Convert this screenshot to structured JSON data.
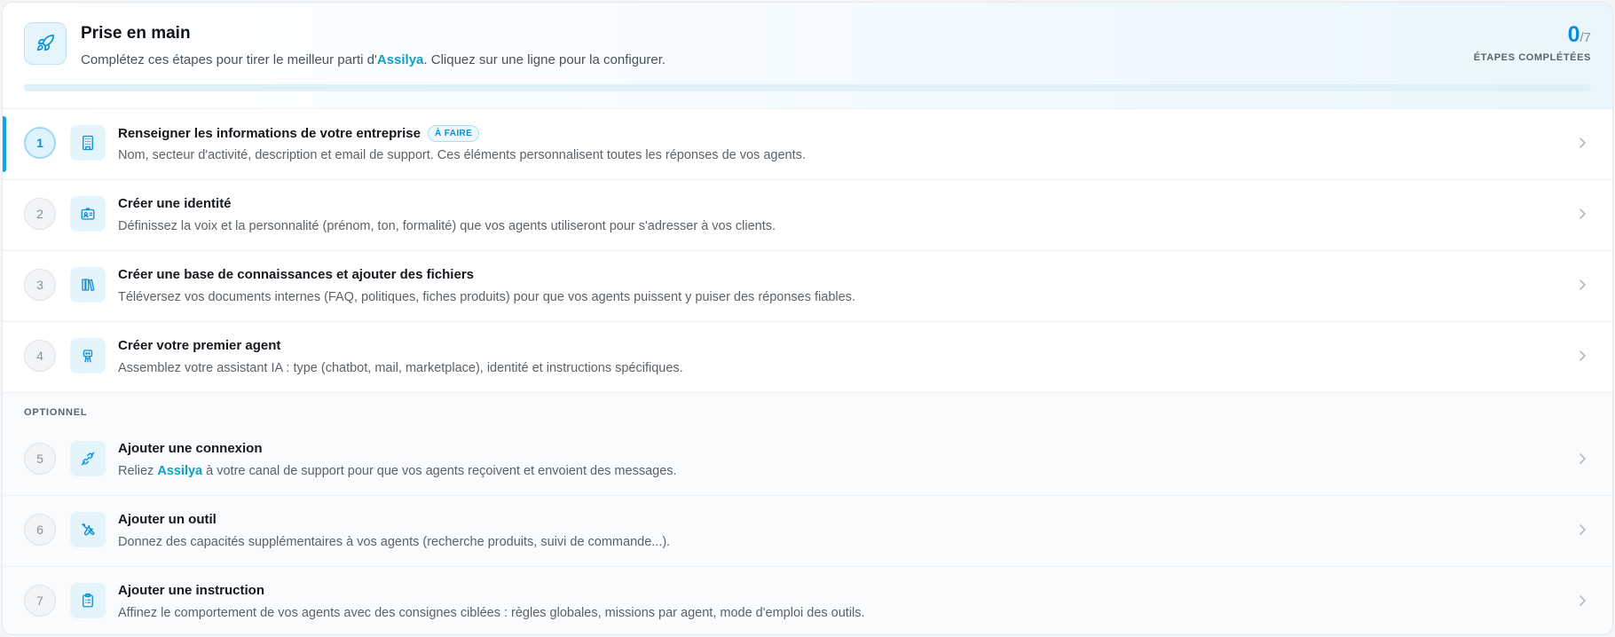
{
  "header": {
    "title": "Prise en main",
    "subtitle_before": "Complétez ces étapes pour tirer le meilleur parti d'",
    "brand": "Assilya",
    "subtitle_after": ". Cliquez sur une ligne pour la configurer.",
    "completed": "0",
    "total": "/7",
    "counter_label": "ÉTAPES COMPLÉTÉES",
    "progress": 0
  },
  "optional_label": "OPTIONNEL",
  "steps": [
    {
      "num": "1",
      "icon": "building-icon",
      "title": "Renseigner les informations de votre entreprise",
      "badge": "À FAIRE",
      "desc": "Nom, secteur d'activité, description et email de support. Ces éléments personnalisent toutes les réponses de vos agents."
    },
    {
      "num": "2",
      "icon": "id-card-icon",
      "title": "Créer une identité",
      "desc": "Définissez la voix et la personnalité (prénom, ton, formalité) que vos agents utiliseront pour s'adresser à vos clients."
    },
    {
      "num": "3",
      "icon": "library-icon",
      "title": "Créer une base de connaissances et ajouter des fichiers",
      "desc": "Téléversez vos documents internes (FAQ, politiques, fiches produits) pour que vos agents puissent y puiser des réponses fiables."
    },
    {
      "num": "4",
      "icon": "robot-icon",
      "title": "Créer votre premier agent",
      "desc": "Assemblez votre assistant IA : type (chatbot, mail, marketplace), identité et instructions spécifiques."
    },
    {
      "num": "5",
      "icon": "plug-icon",
      "title": "Ajouter une connexion",
      "desc_before": "Reliez ",
      "brand": "Assilya",
      "desc_after": " à votre canal de support pour que vos agents reçoivent et envoient des messages."
    },
    {
      "num": "6",
      "icon": "tools-icon",
      "title": "Ajouter un outil",
      "desc": "Donnez des capacités supplémentaires à vos agents (recherche produits, suivi de commande...)."
    },
    {
      "num": "7",
      "icon": "clipboard-icon",
      "title": "Ajouter une instruction",
      "desc": "Affinez le comportement de vos agents avec des consignes ciblées : règles globales, missions par agent, mode d'emploi des outils."
    }
  ],
  "colors": {
    "accent": "#0b8fd6",
    "brand": "#0ea0c6",
    "icon_bg": "#e3f4fb"
  }
}
